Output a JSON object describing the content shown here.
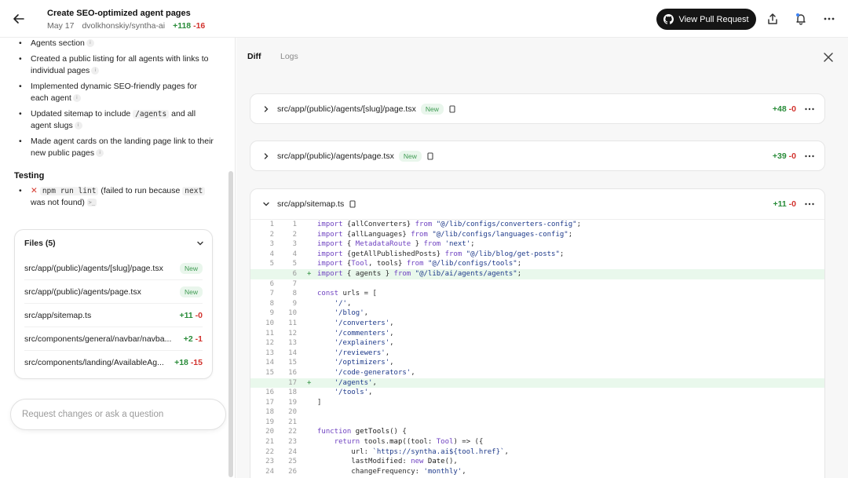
{
  "header": {
    "title": "Create SEO-optimized agent pages",
    "date": "May 17",
    "repo": "dvolkhonskiy/syntha-ai",
    "additions": "+118",
    "deletions": "-16",
    "view_pr_label": "View Pull Request"
  },
  "summary": {
    "bullets": [
      {
        "text": "Agents section"
      },
      {
        "text": "Created a public listing for all agents with links to individual pages"
      },
      {
        "text": "Implemented dynamic SEO-friendly pages for each agent"
      },
      {
        "pre": "Updated sitemap to include ",
        "code": "/agents",
        "post": " and all agent slugs"
      },
      {
        "text": "Made agent cards on the landing page link to their new public pages"
      }
    ],
    "testing_heading": "Testing",
    "testing_item": {
      "code1": "npm run lint",
      "text1": " (failed to run because ",
      "code2": "next",
      "text2": " was not found)"
    }
  },
  "files_panel": {
    "heading": "Files (5)",
    "files": [
      {
        "name": "src/app/(public)/agents/[slug]/page.tsx",
        "badge": "New"
      },
      {
        "name": "src/app/(public)/agents/page.tsx",
        "badge": "New"
      },
      {
        "name": "src/app/sitemap.ts",
        "add": "+11",
        "del": "-0"
      },
      {
        "name": "src/components/general/navbar/navba...",
        "add": "+2",
        "del": "-1"
      },
      {
        "name": "src/components/landing/AvailableAg...",
        "add": "+18",
        "del": "-15"
      }
    ]
  },
  "composer": {
    "placeholder": "Request changes or ask a question"
  },
  "diff_panel": {
    "tabs": [
      "Diff",
      "Logs"
    ],
    "cards": [
      {
        "path": "src/app/(public)/agents/[slug]/page.tsx",
        "badge": "New",
        "add": "+48",
        "del": "-0"
      },
      {
        "path": "src/app/(public)/agents/page.tsx",
        "badge": "New",
        "add": "+39",
        "del": "-0"
      },
      {
        "path": "src/app/sitemap.ts",
        "add": "+11",
        "del": "-0"
      }
    ]
  },
  "code_lines": [
    {
      "old": "1",
      "new": "1",
      "added": false,
      "html": "<span class='kw'>import</span> {allConverters} <span class='kw'>from</span> <span class='str'>\"@/lib/configs/converters-config\"</span>;"
    },
    {
      "old": "2",
      "new": "2",
      "added": false,
      "html": "<span class='kw'>import</span> {allLanguages} <span class='kw'>from</span> <span class='str'>\"@/lib/configs/languages-config\"</span>;"
    },
    {
      "old": "3",
      "new": "3",
      "added": false,
      "html": "<span class='kw'>import</span> { <span class='ty'>MetadataRoute</span> } <span class='kw'>from</span> <span class='str'>'next'</span>;"
    },
    {
      "old": "4",
      "new": "4",
      "added": false,
      "html": "<span class='kw'>import</span> {getAllPublishedPosts} <span class='kw'>from</span> <span class='str'>\"@/lib/blog/get-posts\"</span>;"
    },
    {
      "old": "5",
      "new": "5",
      "added": false,
      "html": "<span class='kw'>import</span> {<span class='ty'>Tool</span>, tools} <span class='kw'>from</span> <span class='str'>\"@/lib/configs/tools\"</span>;"
    },
    {
      "old": "",
      "new": "6",
      "added": true,
      "html": "<span class='kw'>import</span> { agents } <span class='kw'>from</span> <span class='str'>\"@/lib/ai/agents/agents\"</span>;"
    },
    {
      "old": "6",
      "new": "7",
      "added": false,
      "html": ""
    },
    {
      "old": "7",
      "new": "8",
      "added": false,
      "html": "<span class='kw'>const</span> urls = ["
    },
    {
      "old": "8",
      "new": "9",
      "added": false,
      "html": "    <span class='str'>'/'</span>,"
    },
    {
      "old": "9",
      "new": "10",
      "added": false,
      "html": "    <span class='str'>'/blog'</span>,"
    },
    {
      "old": "10",
      "new": "11",
      "added": false,
      "html": "    <span class='str'>'/converters'</span>,"
    },
    {
      "old": "11",
      "new": "12",
      "added": false,
      "html": "    <span class='str'>'/commenters'</span>,"
    },
    {
      "old": "12",
      "new": "13",
      "added": false,
      "html": "    <span class='str'>'/explainers'</span>,"
    },
    {
      "old": "13",
      "new": "14",
      "added": false,
      "html": "    <span class='str'>'/reviewers'</span>,"
    },
    {
      "old": "14",
      "new": "15",
      "added": false,
      "html": "    <span class='str'>'/optimizers'</span>,"
    },
    {
      "old": "15",
      "new": "16",
      "added": false,
      "html": "    <span class='str'>'/code-generators'</span>,"
    },
    {
      "old": "",
      "new": "17",
      "added": true,
      "html": "    <span class='str'>'/agents'</span>,"
    },
    {
      "old": "16",
      "new": "18",
      "added": false,
      "html": "    <span class='str'>'/tools'</span>,"
    },
    {
      "old": "17",
      "new": "19",
      "added": false,
      "html": "]"
    },
    {
      "old": "18",
      "new": "20",
      "added": false,
      "html": ""
    },
    {
      "old": "19",
      "new": "21",
      "added": false,
      "html": ""
    },
    {
      "old": "20",
      "new": "22",
      "added": false,
      "html": "<span class='kw'>function</span> <span class='fn'>getTools</span>() {"
    },
    {
      "old": "21",
      "new": "23",
      "added": false,
      "html": "    <span class='kw'>return</span> tools.<span class='fn'>map</span>((tool: <span class='ty'>Tool</span>) => ({"
    },
    {
      "old": "22",
      "new": "24",
      "added": false,
      "html": "        url: <span class='str'>`https://syntha.ai${tool.href}`</span>,"
    },
    {
      "old": "23",
      "new": "25",
      "added": false,
      "html": "        lastModified: <span class='kw'>new</span> <span class='fn'>Date</span>(),"
    },
    {
      "old": "24",
      "new": "26",
      "added": false,
      "html": "        changeFrequency: <span class='str'>'monthly'</span>,"
    }
  ]
}
